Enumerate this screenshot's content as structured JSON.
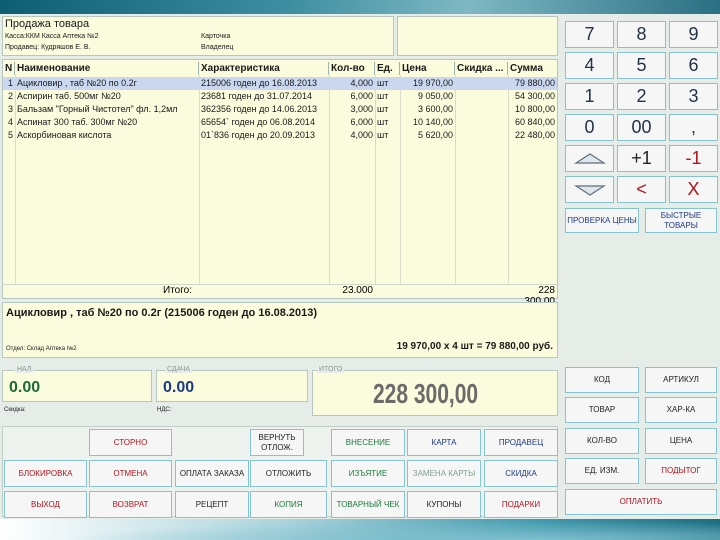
{
  "header": {
    "title": "Продажа товара",
    "line1": "Касса:ККМ Касса Аптека №2",
    "line2": "Продавец: Кудряшов Е. В.",
    "card_label": "Карточка",
    "owner_label": "Владелец"
  },
  "grid": {
    "columns": [
      "N",
      "Наименование",
      "Характеристика",
      "Кол-во",
      "Ед.",
      "Цена",
      "Скидка ...",
      "Сумма"
    ],
    "rows": [
      {
        "n": "1",
        "name": "Ацикловир , таб №20 по 0.2г",
        "char": "215006 годен до 16.08.2013",
        "qty": "4,000",
        "unit": "шт",
        "price": "19 970,00",
        "discount": "",
        "sum": "79 880,00"
      },
      {
        "n": "2",
        "name": "Аспирин таб. 500мг №20",
        "char": "23681 годен до 31.07.2014",
        "qty": "6,000",
        "unit": "шт",
        "price": "9 050,00",
        "discount": "",
        "sum": "54 300,00"
      },
      {
        "n": "3",
        "name": "Бальзам \"Горный Чистотел\" фл. 1,2мл",
        "char": "362356 годен до 14.06.2013",
        "qty": "3,000",
        "unit": "шт",
        "price": "3 600,00",
        "discount": "",
        "sum": "10 800,00"
      },
      {
        "n": "4",
        "name": "Аспинат 300 таб. 300мг №20",
        "char": "65654` годен до 06.08.2014",
        "qty": "6,000",
        "unit": "шт",
        "price": "10 140,00",
        "discount": "",
        "sum": "60 840,00"
      },
      {
        "n": "5",
        "name": "Аскорбиновая кислота",
        "char": "01`836 годен до 20.09.2013",
        "qty": "4,000",
        "unit": "шт",
        "price": "5 620,00",
        "discount": "",
        "sum": "22 480,00"
      }
    ],
    "total_label": "Итого:",
    "total_qty": "23.000",
    "total_sum": "228 300,00"
  },
  "selected": {
    "title": "Ацикловир , таб №20 по 0.2г (215006 годен до 16.08.2013)",
    "warehouse": "Отдел: Склад Аптека №2",
    "calc": "19 970,00  x 4 шт = 79 880,00  руб."
  },
  "payment": {
    "cash_label": "НАЛ",
    "cash_value": "0.00",
    "change_label": "СДАЧА",
    "change_value": "0.00",
    "total_label": "ИТОГО",
    "total_value": "228 300,00",
    "discount_label": "Скидка:",
    "vat_label": "НДС:"
  },
  "keypad": {
    "k7": "7",
    "k8": "8",
    "k9": "9",
    "k4": "4",
    "k5": "5",
    "k6": "6",
    "k1": "1",
    "k2": "2",
    "k3": "3",
    "k0": "0",
    "k00": "00",
    "kcomma": ",",
    "plus1": "+1",
    "minus1": "-1",
    "backspace": "<",
    "clear": "X"
  },
  "right_buttons": {
    "check_price": "ПРОВЕРКА ЦЕНЫ",
    "quick_goods": "БЫСТРЫЕ ТОВАРЫ",
    "code": "КОД",
    "article": "АРТИКУЛ",
    "goods": "ТОВАР",
    "characteristic": "ХАР-КА",
    "quantity": "КОЛ-ВО",
    "price": "ЦЕНА",
    "unit": "ЕД. ИЗМ.",
    "subtotal": "ПОДЫТОГ",
    "pay": "ОПЛАТИТЬ"
  },
  "bottom_buttons": {
    "storno": "СТОРНО",
    "return_deferred": "ВЕРНУТЬ ОТЛОЖ.",
    "deposit": "ВНЕСЕНИЕ",
    "card": "КАРТА",
    "seller": "ПРОДАВЕЦ",
    "block": "БЛОКИРОВКА",
    "cancel": "ОТМЕНА",
    "pay_order": "ОПЛАТА ЗАКАЗА",
    "defer": "ОТЛОЖИТЬ",
    "withdraw": "ИЗЪЯТИЕ",
    "replace_card": "ЗАМЕНА КАРТЫ",
    "discount": "СКИДКА",
    "exit": "ВЫХОД",
    "refund": "ВОЗВРАТ",
    "prescription": "РЕЦЕПТ",
    "copy": "КОПИЯ",
    "sales_receipt": "ТОВАРНЫЙ ЧЕК",
    "coupons": "КУПОНЫ",
    "gifts": "ПОДАРКИ"
  }
}
